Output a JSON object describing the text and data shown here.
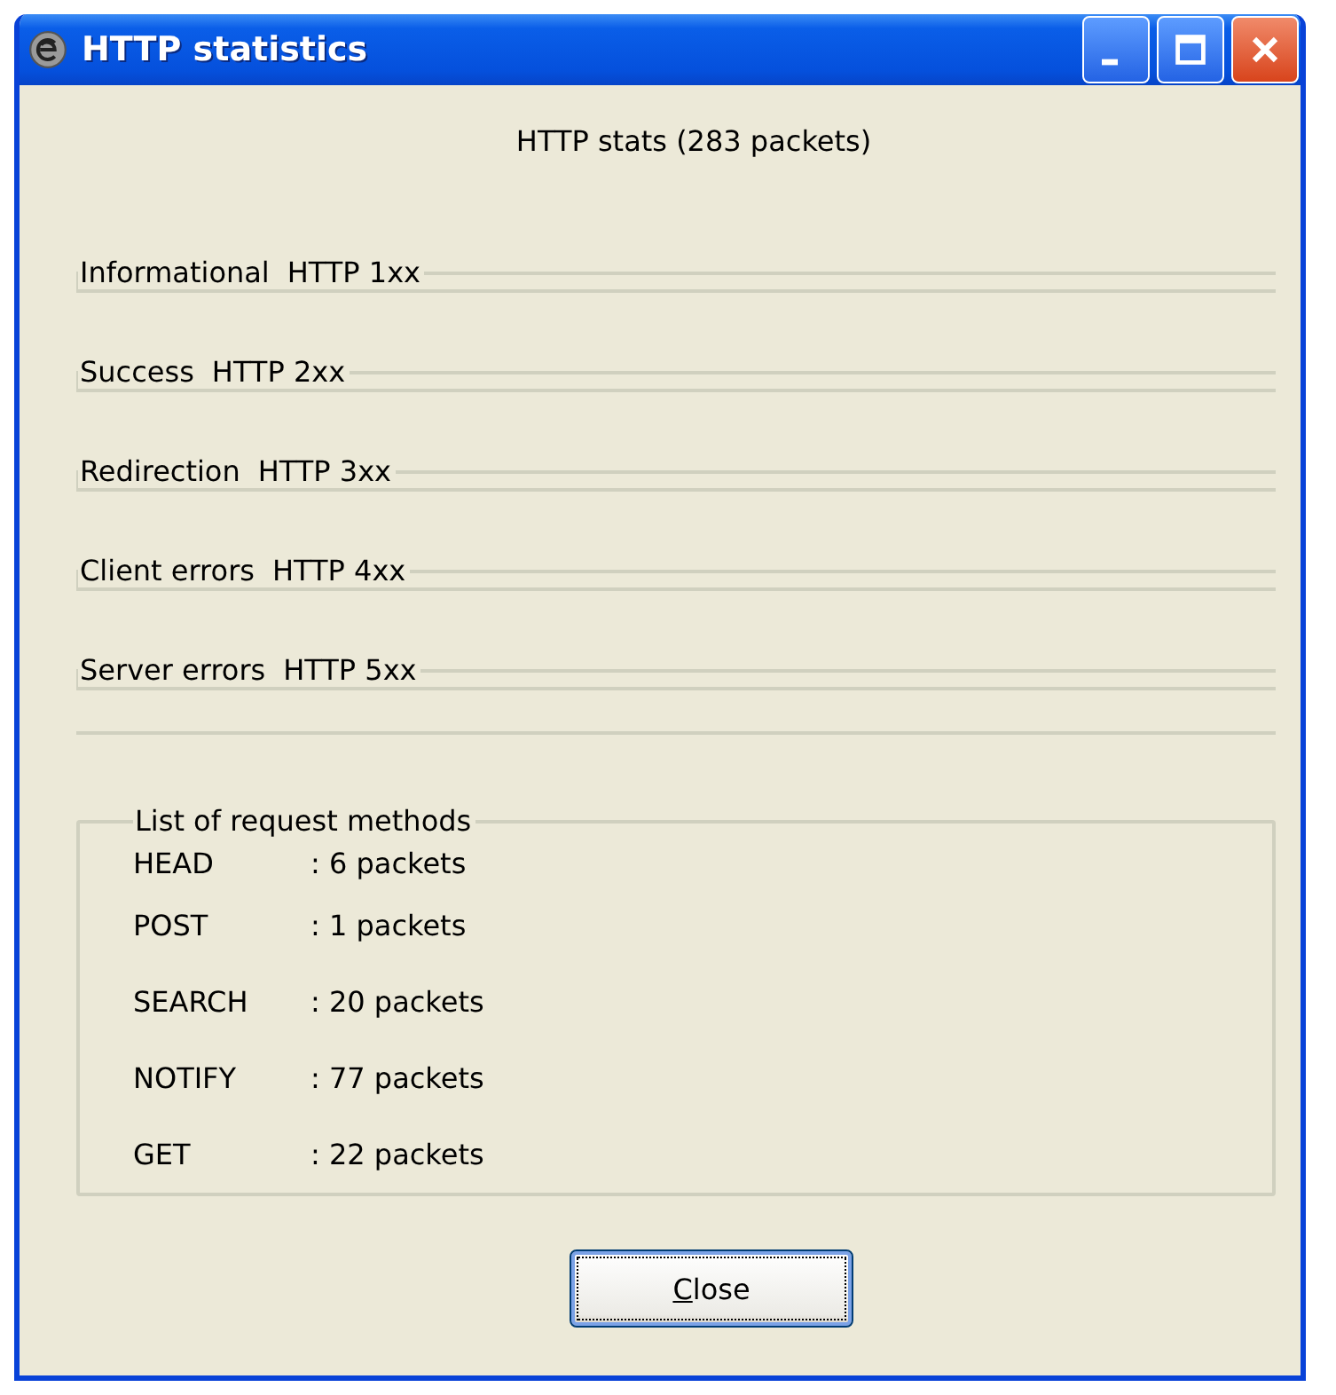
{
  "window": {
    "title": "HTTP statistics"
  },
  "heading": "HTTP stats (283 packets)",
  "status_groups": [
    {
      "label": "Informational",
      "code": "HTTP 1xx"
    },
    {
      "label": "Success",
      "code": "HTTP 2xx"
    },
    {
      "label": "Redirection",
      "code": "HTTP 3xx"
    },
    {
      "label": "Client errors",
      "code": "HTTP 4xx"
    },
    {
      "label": "Server errors",
      "code": "HTTP 5xx"
    }
  ],
  "methods_group": {
    "title": "List of request methods",
    "rows": [
      {
        "method": "HEAD",
        "count": ": 6 packets"
      },
      {
        "method": "POST",
        "count": ": 1 packets"
      },
      {
        "method": "SEARCH",
        "count": ": 20 packets"
      },
      {
        "method": "NOTIFY",
        "count": ": 77 packets"
      },
      {
        "method": "GET",
        "count": ": 22 packets"
      }
    ]
  },
  "buttons": [
    {
      "label": "Close",
      "first_letter_underlined": true,
      "focused": true
    }
  ]
}
